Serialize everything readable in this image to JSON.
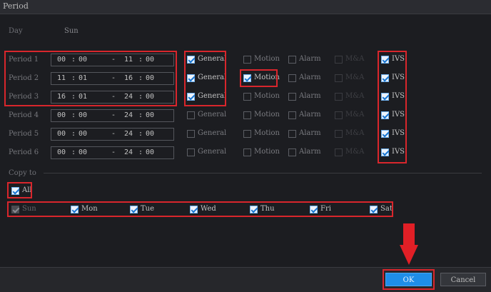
{
  "title": "Period",
  "day_label": "Day",
  "day_value": "Sun",
  "periods": [
    {
      "label": "Period 1",
      "start_h": "00",
      "start_m": "00",
      "end_h": "11",
      "end_m": "00",
      "general": true,
      "motion": false,
      "alarm": false,
      "mda": false,
      "ivs": true
    },
    {
      "label": "Period 2",
      "start_h": "11",
      "start_m": "01",
      "end_h": "16",
      "end_m": "00",
      "general": true,
      "motion": true,
      "alarm": false,
      "mda": false,
      "ivs": true
    },
    {
      "label": "Period 3",
      "start_h": "16",
      "start_m": "01",
      "end_h": "24",
      "end_m": "00",
      "general": true,
      "motion": false,
      "alarm": false,
      "mda": false,
      "ivs": true
    },
    {
      "label": "Period 4",
      "start_h": "00",
      "start_m": "00",
      "end_h": "24",
      "end_m": "00",
      "general": false,
      "motion": false,
      "alarm": false,
      "mda": false,
      "ivs": true
    },
    {
      "label": "Period 5",
      "start_h": "00",
      "start_m": "00",
      "end_h": "24",
      "end_m": "00",
      "general": false,
      "motion": false,
      "alarm": false,
      "mda": false,
      "ivs": true
    },
    {
      "label": "Period 6",
      "start_h": "00",
      "start_m": "00",
      "end_h": "24",
      "end_m": "00",
      "general": false,
      "motion": false,
      "alarm": false,
      "mda": false,
      "ivs": true
    }
  ],
  "event_labels": {
    "general": "General",
    "motion": "Motion",
    "alarm": "Alarm",
    "mda": "M&A",
    "ivs": "IVS"
  },
  "time_separator": ":",
  "range_separator": "-",
  "copy_to_label": "Copy to",
  "all": {
    "label": "All",
    "checked": true
  },
  "days": [
    {
      "label": "Sun",
      "checked": true,
      "disabled": true
    },
    {
      "label": "Mon",
      "checked": true,
      "disabled": false
    },
    {
      "label": "Tue",
      "checked": true,
      "disabled": false
    },
    {
      "label": "Wed",
      "checked": true,
      "disabled": false
    },
    {
      "label": "Thu",
      "checked": true,
      "disabled": false
    },
    {
      "label": "Fri",
      "checked": true,
      "disabled": false
    },
    {
      "label": "Sat",
      "checked": true,
      "disabled": false
    }
  ],
  "ok_label": "OK",
  "cancel_label": "Cancel",
  "accent_color": "#1f8ee8",
  "highlight_color": "#d8262c"
}
